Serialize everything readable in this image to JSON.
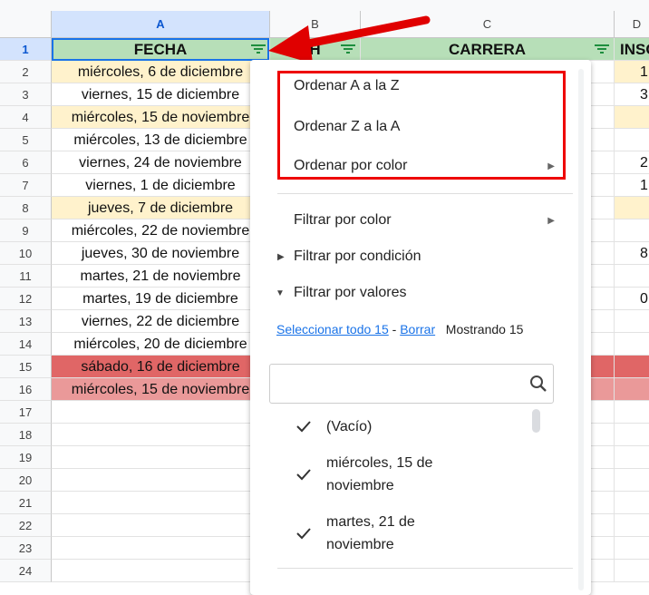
{
  "columns": [
    "A",
    "B",
    "C",
    "D"
  ],
  "headers": {
    "fecha": "FECHA",
    "b": "H",
    "carrera": "CARRERA",
    "d": "INSC"
  },
  "rows": [
    {
      "n": "1"
    },
    {
      "n": "2",
      "fecha": "miércoles, 6 de diciembre",
      "d": "1"
    },
    {
      "n": "3",
      "fecha": "viernes, 15 de diciembre",
      "d": "3"
    },
    {
      "n": "4",
      "fecha": "miércoles, 15 de noviembre",
      "d": ""
    },
    {
      "n": "5",
      "fecha": "miércoles, 13 de diciembre",
      "d": ""
    },
    {
      "n": "6",
      "fecha": "viernes, 24 de noviembre",
      "d": "2"
    },
    {
      "n": "7",
      "fecha": "viernes, 1 de diciembre",
      "d": "1"
    },
    {
      "n": "8",
      "fecha": "jueves, 7 de diciembre",
      "d": ""
    },
    {
      "n": "9",
      "fecha": "miércoles, 22 de noviembre",
      "d": ""
    },
    {
      "n": "10",
      "fecha": "jueves, 30 de noviembre",
      "d": "8"
    },
    {
      "n": "11",
      "fecha": "martes, 21 de noviembre",
      "d": ""
    },
    {
      "n": "12",
      "fecha": "martes, 19 de diciembre",
      "d": "0"
    },
    {
      "n": "13",
      "fecha": "viernes, 22 de diciembre",
      "d": ""
    },
    {
      "n": "14",
      "fecha": "miércoles, 20 de diciembre",
      "d": ""
    },
    {
      "n": "15",
      "fecha": "sábado, 16 de diciembre",
      "d": ""
    },
    {
      "n": "16",
      "fecha": "miércoles, 15 de noviembre",
      "d": ""
    },
    {
      "n": "17"
    },
    {
      "n": "18"
    },
    {
      "n": "19"
    },
    {
      "n": "20"
    },
    {
      "n": "21"
    },
    {
      "n": "22"
    },
    {
      "n": "23"
    },
    {
      "n": "24"
    }
  ],
  "row_colors": {
    "highlight_yellow": "#fff2cc",
    "header_green": "#b7dfb8",
    "red_dark": "#e06666",
    "red_light": "#ea9999"
  },
  "menu": {
    "sort_az": "Ordenar A a la Z",
    "sort_za": "Ordenar Z a la A",
    "sort_color": "Ordenar por color",
    "filter_color": "Filtrar por color",
    "filter_condition": "Filtrar por condición",
    "filter_values": "Filtrar por valores",
    "select_all": "Seleccionar todo 15",
    "separator": "-",
    "clear": "Borrar",
    "showing": "Mostrando 15",
    "search_icon": "search-icon",
    "values": [
      {
        "label": "(Vacío)",
        "checked": true
      },
      {
        "label": "miércoles, 15 de noviembre",
        "checked": true
      },
      {
        "label": "martes, 21 de noviembre",
        "checked": true
      }
    ]
  },
  "annotation": {
    "arrow_color": "#e00000",
    "box_color": "#e00000"
  }
}
